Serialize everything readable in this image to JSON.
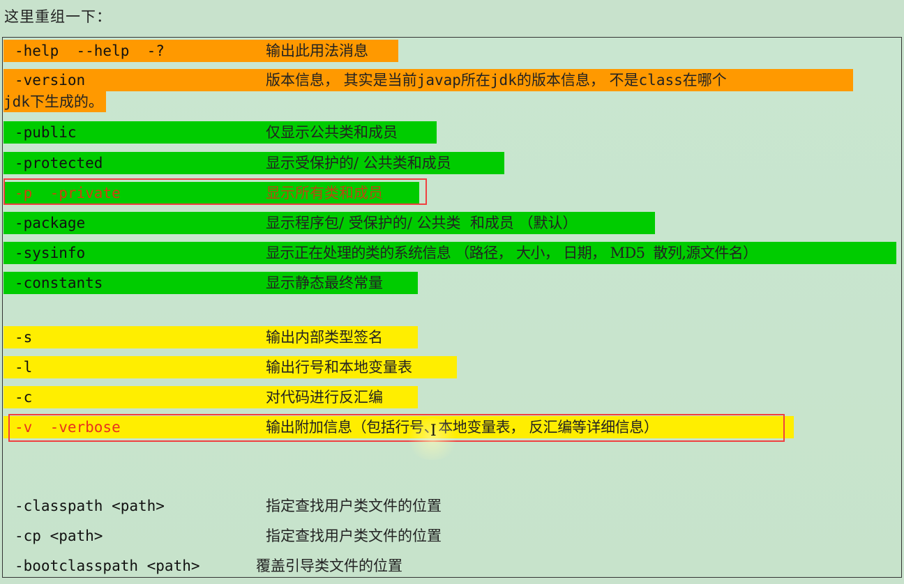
{
  "heading": "这里重组一下：",
  "colors": {
    "orange": "#ff9900",
    "green": "#00cc00",
    "yellow": "#ffee00",
    "highlight_red": "#f04040",
    "option_red": "#e8331e"
  },
  "groups": {
    "basic": [
      {
        "option": "-help  --help  -?",
        "desc": "输出此用法消息"
      },
      {
        "option": "-version",
        "desc_parts": [
          "版本信息， 其实是当前",
          "javap",
          "所在",
          "jdk",
          "的版本信息， 不是",
          "class",
          "在哪个"
        ],
        "desc_cont_parts": [
          "jdk",
          "下生成的。"
        ]
      }
    ],
    "visibility": [
      {
        "option": "-public",
        "desc": "仅显示公共类和成员"
      },
      {
        "option": "-protected",
        "desc": "显示受保护的/ 公共类和成员"
      },
      {
        "option": "-p  -private",
        "desc": "显示所有类和成员",
        "highlighted": true
      },
      {
        "option": "-package",
        "desc": "显示程序包/ 受保护的/ 公共类  和成员 （默认）"
      },
      {
        "option": "-sysinfo",
        "desc": "显示正在处理的类的系统信息 （路径， 大小， 日期， MD5  散列,源文件名）"
      },
      {
        "option": "-constants",
        "desc": "显示静态最终常量"
      }
    ],
    "output": [
      {
        "option": "-s",
        "desc": "输出内部类型签名"
      },
      {
        "option": "-l",
        "desc": "输出行号和本地变量表"
      },
      {
        "option": "-c",
        "desc": "对代码进行反汇编"
      },
      {
        "option": "-v  -verbose",
        "desc": "输出附加信息（包括行号、本地变量表， 反汇编等详细信息）",
        "highlighted": true
      }
    ],
    "path": [
      {
        "option": "-classpath <path>",
        "desc": "指定查找用户类文件的位置"
      },
      {
        "option": "-cp <path>",
        "desc": "指定查找用户类文件的位置"
      },
      {
        "option": "-bootclasspath <path>",
        "desc": "覆盖引导类文件的位置"
      }
    ]
  }
}
